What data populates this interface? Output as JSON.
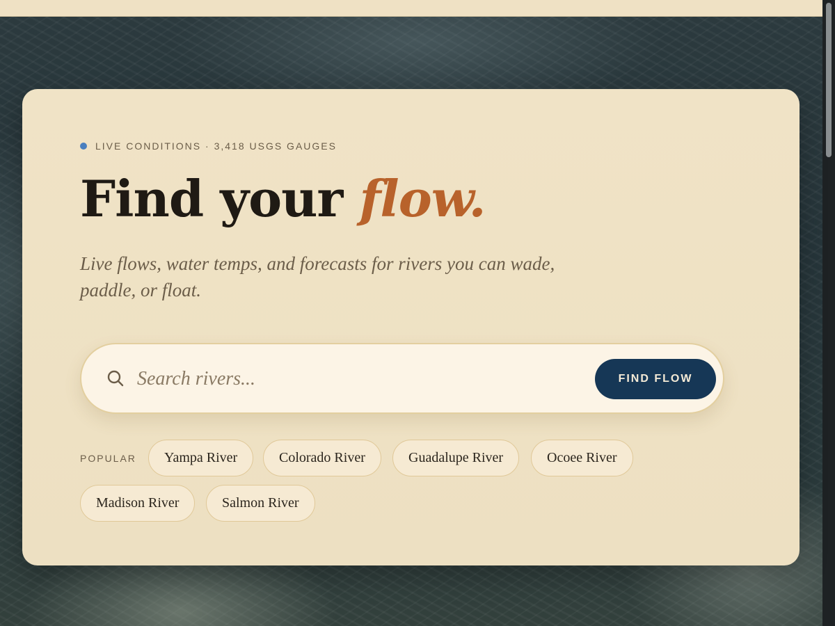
{
  "hero": {
    "eyebrow": "LIVE CONDITIONS · 3,418 USGS GAUGES",
    "headline_main": "Find your ",
    "headline_accent": "flow.",
    "subtitle": "Live flows, water temps, and forecasts for rivers you can wade, paddle, or float."
  },
  "search": {
    "placeholder": "Search rivers...",
    "value": "",
    "icon": "search-icon",
    "button_label": "FIND FLOW"
  },
  "popular": {
    "label": "POPULAR",
    "rivers": [
      "Yampa River",
      "Colorado River",
      "Guadalupe River",
      "Ocoee River",
      "Madison River",
      "Salmon River"
    ]
  },
  "colors": {
    "accent": "#b8622b",
    "button": "#163756",
    "live_dot": "#4a7fbf",
    "card": "#efe2c4"
  }
}
